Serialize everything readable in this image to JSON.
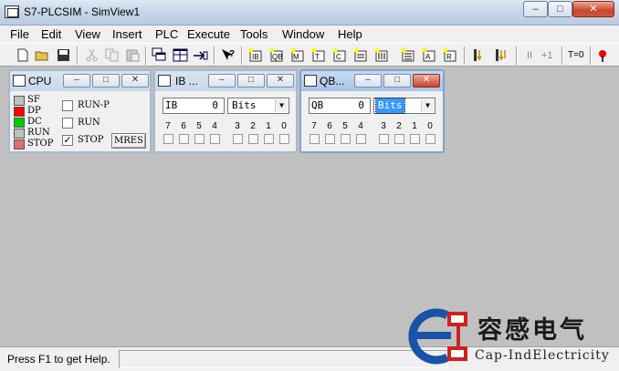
{
  "window": {
    "title": "S7-PLCSIM - SimView1",
    "min_glyph": "–",
    "max_glyph": "□",
    "close_glyph": "✕"
  },
  "menu": [
    {
      "label": "File"
    },
    {
      "label": "Edit"
    },
    {
      "label": "View"
    },
    {
      "label": "Insert"
    },
    {
      "label": "PLC"
    },
    {
      "label": "Execute"
    },
    {
      "label": "Tools"
    },
    {
      "label": "Window"
    },
    {
      "label": "Help"
    }
  ],
  "toolbar": {
    "cycle_text": "T=0",
    "step_text": "+1",
    "pause_text": "II"
  },
  "cpu_window": {
    "title": "CPU",
    "leds": [
      {
        "label": "SF",
        "color": "#c0c0c0"
      },
      {
        "label": "DP",
        "color": "#ff0000"
      },
      {
        "label": "DC",
        "color": "#00cc00"
      },
      {
        "label": "RUN",
        "color": "#c0c0c0"
      },
      {
        "label": "STOP",
        "color": "#e07070"
      }
    ],
    "modes": [
      {
        "label": "RUN-P",
        "checked": ""
      },
      {
        "label": "RUN",
        "checked": ""
      },
      {
        "label": "STOP",
        "checked": "✓"
      }
    ],
    "mres_label": "MRES"
  },
  "ib_window": {
    "title": "IB ...",
    "address_prefix": "IB",
    "address_value": "0",
    "format": "Bits",
    "bits": [
      "7",
      "6",
      "5",
      "4",
      "3",
      "2",
      "1",
      "0"
    ]
  },
  "qb_window": {
    "title": "QB...",
    "address_prefix": "QB",
    "address_value": "0",
    "format": "Bits",
    "bits": [
      "7",
      "6",
      "5",
      "4",
      "3",
      "2",
      "1",
      "0"
    ]
  },
  "status": {
    "text": "Press F1 to get Help."
  },
  "logo": {
    "cn": "容感电气",
    "en": "Cap-IndElectricity"
  }
}
